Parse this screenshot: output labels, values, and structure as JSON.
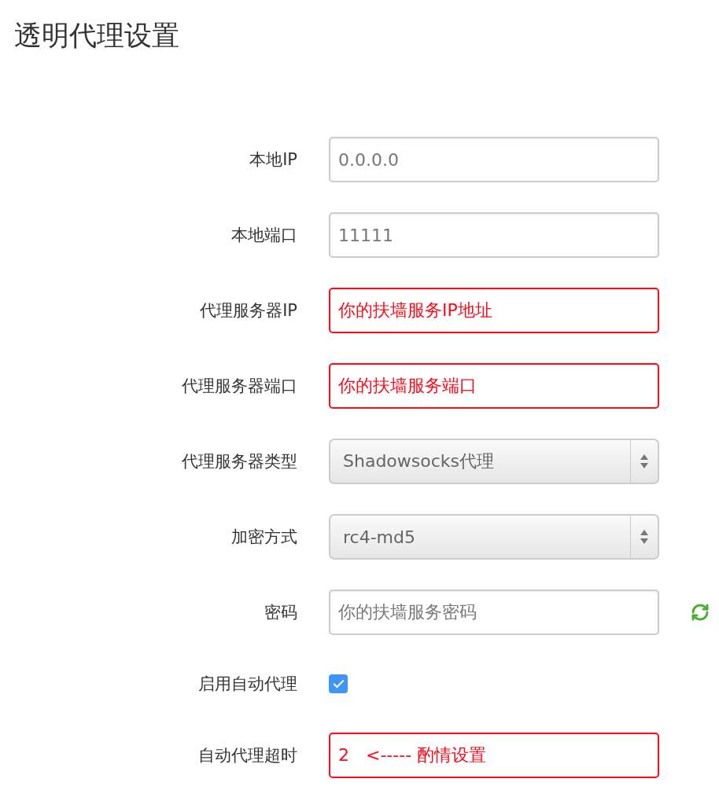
{
  "title": "透明代理设置",
  "fields": [
    {
      "kind": "text",
      "label": "本地IP",
      "value": "0.0.0.0",
      "highlighted": false
    },
    {
      "kind": "text",
      "label": "本地端口",
      "value": "11111",
      "highlighted": false
    },
    {
      "kind": "text",
      "label": "代理服务器IP",
      "value": "你的扶墙服务IP地址",
      "highlighted": true
    },
    {
      "kind": "text",
      "label": "代理服务器端口",
      "value": "你的扶墙服务端口",
      "highlighted": true
    },
    {
      "kind": "select",
      "label": "代理服务器类型",
      "value": "Shadowsocks代理",
      "highlighted": false
    },
    {
      "kind": "select",
      "label": "加密方式",
      "value": "rc4-md5",
      "highlighted": false
    },
    {
      "kind": "password",
      "label": "密码",
      "value": "你的扶墙服务密码",
      "highlighted": false
    },
    {
      "kind": "checkbox",
      "label": "启用自动代理",
      "checked": true
    },
    {
      "kind": "text",
      "label": "自动代理超时",
      "value": "2   <----- 酌情设置",
      "highlighted": true
    }
  ]
}
